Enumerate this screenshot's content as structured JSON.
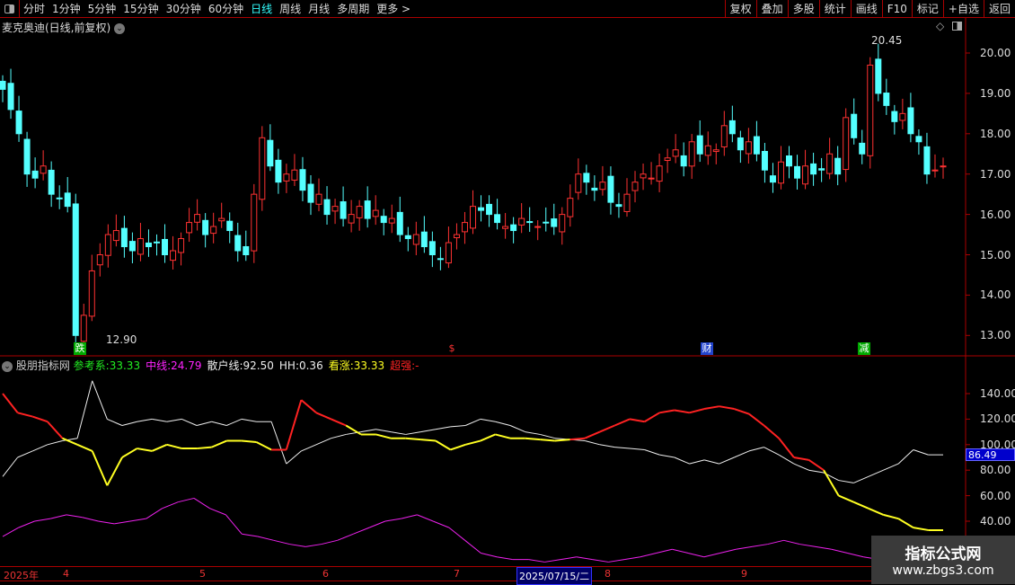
{
  "toolbar": {
    "periods": [
      "分时",
      "1分钟",
      "5分钟",
      "15分钟",
      "30分钟",
      "60分钟",
      "日线",
      "周线",
      "月线",
      "多周期",
      "更多 >"
    ],
    "active": "日线",
    "right": [
      "复权",
      "叠加",
      "多股",
      "统计",
      "画线",
      "F10",
      "标记",
      "+自选",
      "返回"
    ]
  },
  "title": "麦克奥迪(日线,前复权)",
  "price_axis": [
    "20.00",
    "19.00",
    "18.00",
    "17.00",
    "16.00",
    "15.00",
    "14.00",
    "13.00"
  ],
  "high_label": "20.45",
  "low_label": "12.90",
  "markers": [
    "跌",
    "$",
    "财",
    "减"
  ],
  "indicator": {
    "name": "股朋指标网",
    "items": [
      {
        "k": "参考系:",
        "v": "33.33",
        "c": "#2e2"
      },
      {
        "k": "中线:",
        "v": "24.79",
        "c": "#f2f"
      },
      {
        "k": "散户线:",
        "v": "92.50",
        "c": "#eee"
      },
      {
        "k": "HH:",
        "v": "0.36",
        "c": "#eee"
      },
      {
        "k": "看涨:",
        "v": "33.33",
        "c": "#ff2"
      },
      {
        "k": "超强:",
        "v": "-",
        "c": "#f22"
      }
    ]
  },
  "ind_axis": [
    "140.00",
    "120.00",
    "100.00",
    "80.00",
    "60.00",
    "40.00"
  ],
  "ind_current": "86.49",
  "dates": {
    "year": "2025年",
    "months": [
      "4",
      "5",
      "6",
      "7",
      "8",
      "9"
    ],
    "cursor": "2025/07/15/二"
  },
  "watermark": {
    "title": "指标公式网",
    "url": "www.zbgs3.com"
  },
  "colors": {
    "up": "#ff3232",
    "down": "#54ffff",
    "frame": "#aa0000"
  },
  "chart_data": {
    "type": "candlestick",
    "closes": [
      19.1,
      18.6,
      18.0,
      17.0,
      16.9,
      17.2,
      16.5,
      16.4,
      16.2,
      13.0,
      13.5,
      14.6,
      15.0,
      15.5,
      15.6,
      15.2,
      15.1,
      15.4,
      15.2,
      15.3,
      15.0,
      15.1,
      15.4,
      15.8,
      16.0,
      15.5,
      15.7,
      15.9,
      15.6,
      15.1,
      15.0,
      16.5,
      17.9,
      17.2,
      16.8,
      17.0,
      17.1,
      16.6,
      16.3,
      16.5,
      16.0,
      16.2,
      15.9,
      16.0,
      16.2,
      15.9,
      16.1,
      15.8,
      15.9,
      15.5,
      15.4,
      15.5,
      15.2,
      15.0,
      14.9,
      15.3,
      15.5,
      15.8,
      16.2,
      16.1,
      16.0,
      15.8,
      15.7,
      15.6,
      15.9,
      15.8,
      15.7,
      15.8,
      15.7,
      16.0,
      16.4,
      17.0,
      16.8,
      16.6,
      16.8,
      16.3,
      16.2,
      16.5,
      16.8,
      17.0,
      16.9,
      17.2,
      17.4,
      17.6,
      17.2,
      17.8,
      17.5,
      17.7,
      17.6,
      18.2,
      18.0,
      17.6,
      17.8,
      17.5,
      17.1,
      16.8,
      17.3,
      17.2,
      16.9,
      17.2,
      17.0,
      17.1,
      17.5,
      17.0,
      18.4,
      17.9,
      17.5,
      19.7,
      19.0,
      18.7,
      18.3,
      18.5,
      18.0,
      17.8,
      17.0,
      17.1,
      17.2
    ],
    "ylim": [
      12.7,
      20.7
    ],
    "lines": {
      "white": [
        75,
        90,
        95,
        100,
        103,
        105,
        150,
        120,
        115,
        118,
        120,
        118,
        120,
        115,
        118,
        115,
        120,
        118,
        118,
        85,
        95,
        100,
        105,
        108,
        110,
        112,
        110,
        108,
        110,
        112,
        114,
        115,
        120,
        118,
        115,
        110,
        108,
        105,
        104,
        103,
        100,
        98,
        97,
        96,
        92,
        90,
        85,
        88,
        85,
        90,
        95,
        98,
        92,
        85,
        80,
        78,
        72,
        70,
        75,
        80,
        85,
        96,
        92,
        92
      ],
      "main": [
        140,
        125,
        122,
        118,
        105,
        100,
        95,
        68,
        90,
        97,
        95,
        100,
        97,
        97,
        98,
        103,
        103,
        102,
        96,
        96,
        135,
        125,
        120,
        115,
        108,
        108,
        105,
        105,
        104,
        103,
        96,
        100,
        103,
        108,
        105,
        105,
        104,
        103,
        104,
        105,
        110,
        115,
        120,
        118,
        125,
        127,
        125,
        128,
        130,
        128,
        124,
        115,
        105,
        90,
        88,
        80,
        60,
        55,
        50,
        45,
        42,
        35,
        33,
        33
      ],
      "magenta": [
        28,
        35,
        40,
        42,
        45,
        43,
        40,
        38,
        40,
        42,
        50,
        55,
        58,
        50,
        45,
        30,
        28,
        25,
        22,
        20,
        22,
        25,
        30,
        35,
        40,
        42,
        45,
        40,
        35,
        25,
        15,
        12,
        10,
        10,
        8,
        10,
        12,
        10,
        8,
        10,
        12,
        15,
        18,
        15,
        12,
        15,
        18,
        20,
        22,
        25,
        22,
        20,
        18,
        15,
        12,
        10,
        12,
        15,
        16,
        17
      ]
    },
    "ind_ylim": [
      0,
      165
    ]
  }
}
